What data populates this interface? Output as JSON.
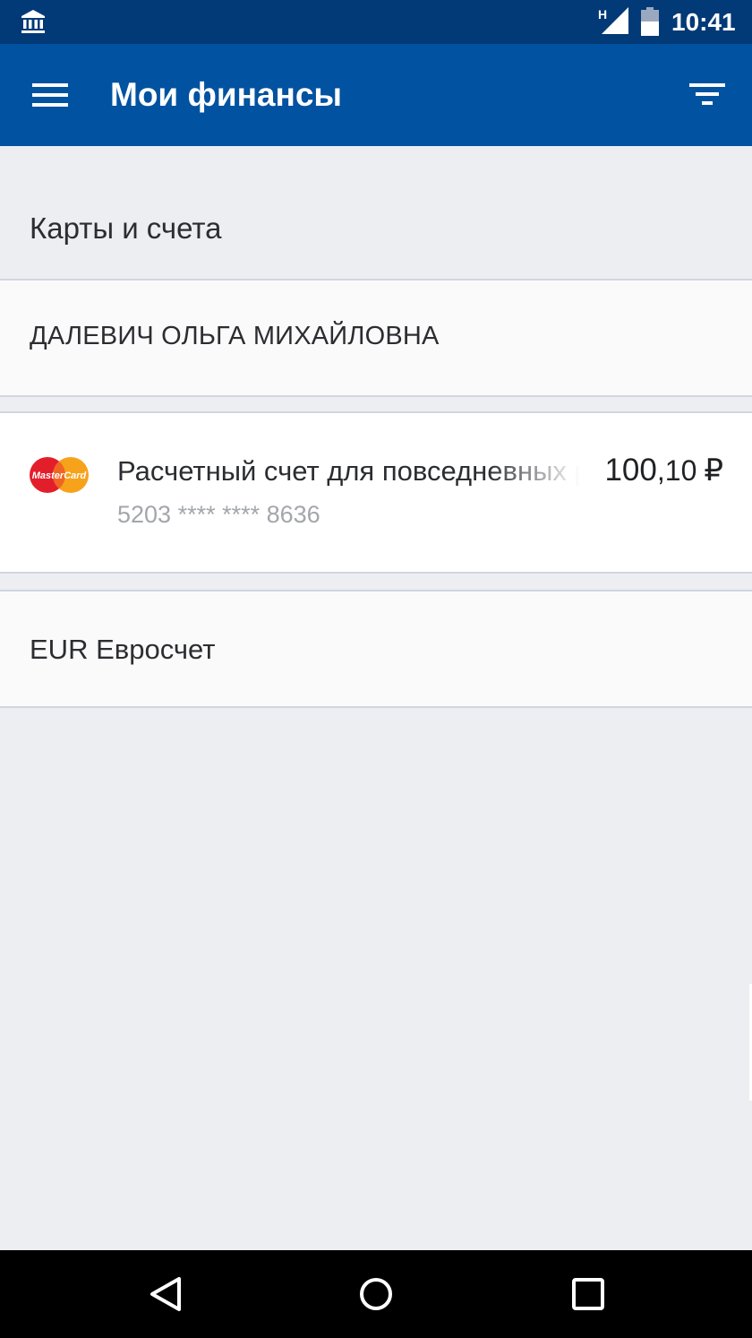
{
  "status_bar": {
    "network_type": "H",
    "time": "10:41",
    "icons": [
      "bank-icon",
      "signal-icon",
      "battery-icon"
    ]
  },
  "app_bar": {
    "title": "Мои финансы",
    "icons": [
      "menu-icon",
      "filter-icon"
    ]
  },
  "section": {
    "title": "Карты и счета"
  },
  "owner": {
    "name": "ДАЛЕВИЧ ОЛЬГА МИХАЙЛОВНА"
  },
  "account": {
    "name": "Расчетный счет для повседневных расходов",
    "card_number": "5203 **** **** 8636",
    "amount_int": "100",
    "amount_frac": ",10",
    "currency": "₽",
    "card_brand": "MasterCard",
    "icon": "mastercard-icon"
  },
  "euro_account": {
    "label": "EUR Евросчет"
  },
  "navigation": {
    "icons": [
      "back-icon",
      "home-icon",
      "recent-apps-icon"
    ]
  },
  "colors": {
    "status_bar": "#013a76",
    "app_bar": "#0152a0",
    "background": "#eceef2",
    "card": "#ffffff",
    "text": "#2b2d30",
    "secondary_text": "#a3a6ab"
  }
}
